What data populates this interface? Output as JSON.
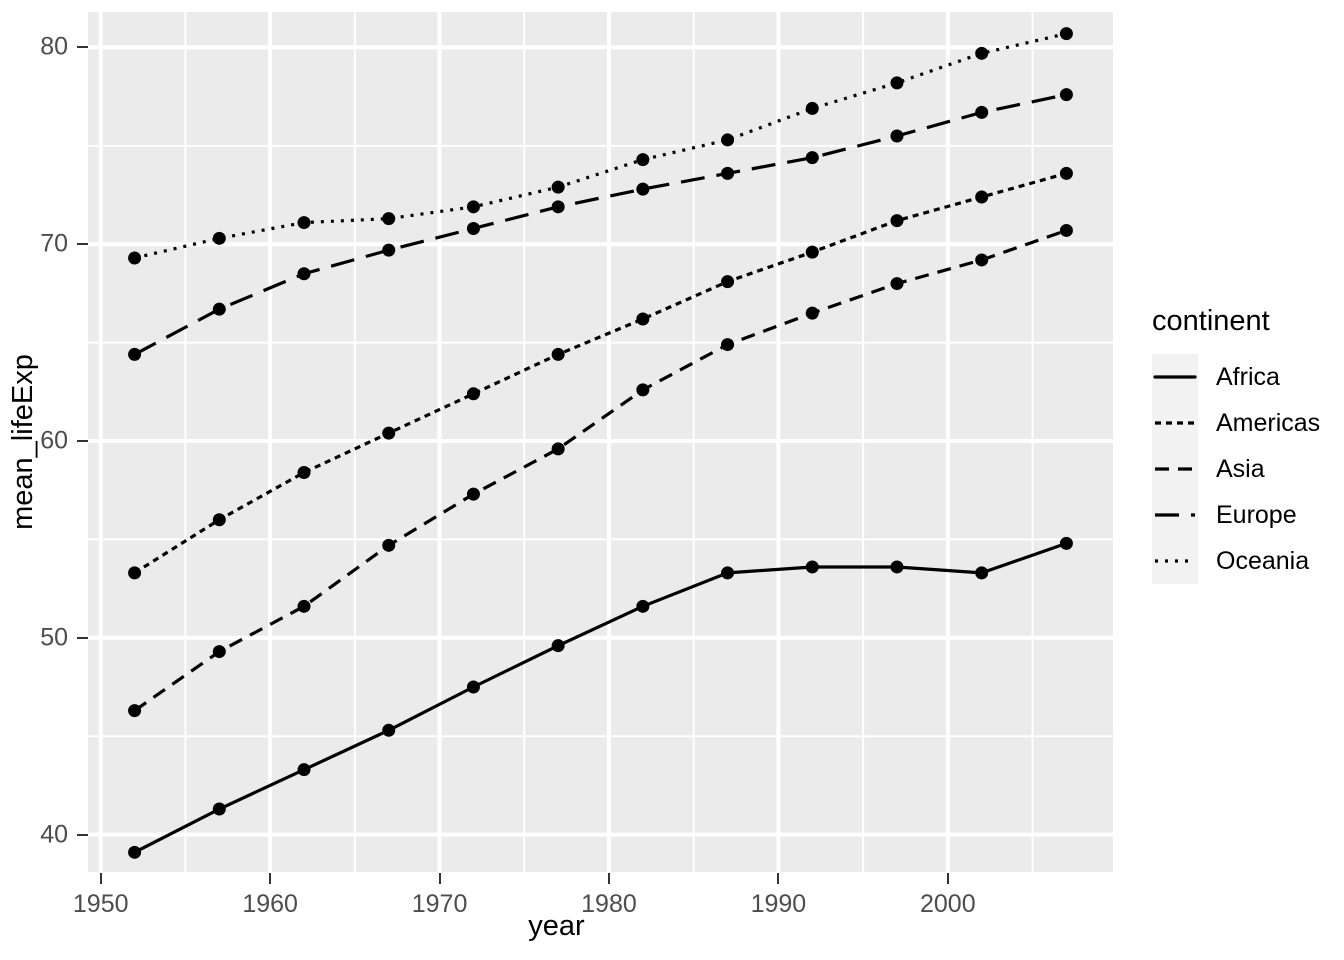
{
  "chart_data": {
    "type": "line",
    "title": "",
    "subtitle": "",
    "xlabel": "year",
    "ylabel": "mean_lifeExp",
    "x": [
      1952,
      1957,
      1962,
      1967,
      1972,
      1977,
      1982,
      1987,
      1992,
      1997,
      2002,
      2007
    ],
    "xlim": [
      1949.25,
      2009.75
    ],
    "ylim": [
      38.1,
      81.8
    ],
    "x_ticks": [
      1950,
      1960,
      1970,
      1980,
      1990,
      2000
    ],
    "y_ticks": [
      40,
      50,
      60,
      70,
      80
    ],
    "grid": true,
    "minor_grid": true,
    "legend_position": "right",
    "legend_title": "continent",
    "markers": "filled-circle",
    "series": [
      {
        "name": "Africa",
        "linetype": "solid",
        "dasharray": "",
        "values": [
          39.1,
          41.3,
          43.3,
          45.3,
          47.5,
          49.6,
          51.6,
          53.3,
          53.6,
          53.6,
          53.3,
          54.8
        ]
      },
      {
        "name": "Americas",
        "linetype": "dotted",
        "dasharray": "6,5",
        "values": [
          53.3,
          56.0,
          58.4,
          60.4,
          62.4,
          64.4,
          66.2,
          68.1,
          69.6,
          71.2,
          72.4,
          73.6
        ]
      },
      {
        "name": "Asia",
        "linetype": "dashed",
        "dasharray": "14,9",
        "values": [
          46.3,
          49.3,
          51.6,
          54.7,
          57.3,
          59.6,
          62.6,
          64.9,
          66.5,
          68.0,
          69.2,
          70.7
        ]
      },
      {
        "name": "Europe",
        "linetype": "longdash",
        "dasharray": "24,12",
        "values": [
          64.4,
          66.7,
          68.5,
          69.7,
          70.8,
          71.9,
          72.8,
          73.6,
          74.4,
          75.5,
          76.7,
          77.6
        ]
      },
      {
        "name": "Oceania",
        "linetype": "dotted-fine",
        "dasharray": "3,7",
        "values": [
          69.3,
          70.3,
          71.1,
          71.3,
          71.9,
          72.9,
          74.3,
          75.3,
          76.9,
          78.2,
          79.7,
          80.7
        ]
      }
    ]
  },
  "axes": {
    "y_tick_labels": [
      "40",
      "50",
      "60",
      "70",
      "80"
    ],
    "x_tick_labels": [
      "1950",
      "1960",
      "1970",
      "1980",
      "1990",
      "2000"
    ],
    "y_title": "mean_lifeExp",
    "x_title": "year"
  },
  "legend": {
    "title": "continent",
    "items": [
      {
        "label": "Africa"
      },
      {
        "label": "Americas"
      },
      {
        "label": "Asia"
      },
      {
        "label": "Europe"
      },
      {
        "label": "Oceania"
      }
    ]
  },
  "colors": {
    "panel_background": "#EBEBEB",
    "grid_major": "#FFFFFF",
    "grid_minor": "#FFFFFF",
    "line": "#000000",
    "point": "#000000",
    "axis_text": "#4D4D4D",
    "axis_title": "#000000",
    "legend_key_background": "#F2F2F2",
    "plot_background": "#FFFFFF"
  }
}
